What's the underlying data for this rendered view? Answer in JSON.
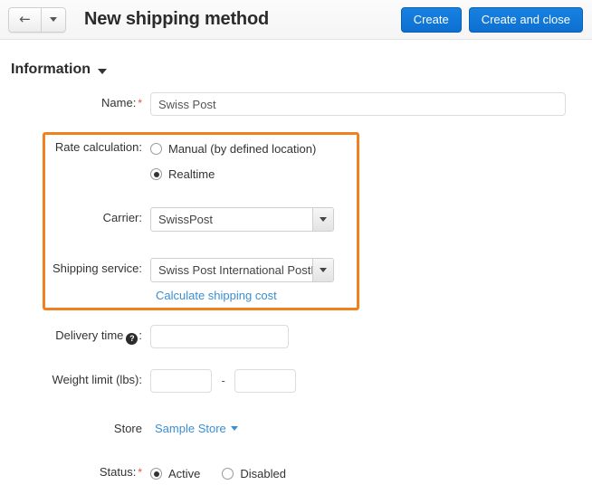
{
  "topbar": {
    "back_icon": "arrow-left-icon",
    "back_dropdown_icon": "caret-down-icon",
    "title": "New shipping method",
    "create_label": "Create",
    "create_and_close_label": "Create and close",
    "accent_color": "#1176d6"
  },
  "section": {
    "title": "Information",
    "collapse_icon": "caret-down-icon"
  },
  "form": {
    "name": {
      "label": "Name:",
      "required": "*",
      "value": "Swiss Post",
      "placeholder": ""
    },
    "rate_calculation": {
      "label": "Rate calculation:",
      "options": [
        {
          "label": "Manual (by defined location)",
          "checked": false
        },
        {
          "label": "Realtime",
          "checked": true
        }
      ]
    },
    "carrier": {
      "label": "Carrier:",
      "value": "SwissPost"
    },
    "shipping_service": {
      "label": "Shipping service:",
      "value": "Swiss Post International PostPa"
    },
    "calculate_link": "Calculate shipping cost",
    "delivery_time": {
      "label": "Delivery time",
      "help_icon": "question-mark-icon",
      "suffix": ":",
      "value": "",
      "placeholder": ""
    },
    "weight_limit": {
      "label": "Weight limit (lbs):",
      "min_value": "",
      "max_value": "",
      "separator": "-",
      "placeholder": ""
    },
    "store": {
      "label": "Store",
      "value": "Sample Store",
      "caret_icon": "caret-down-icon"
    },
    "status": {
      "label": "Status:",
      "required": "*",
      "options": [
        {
          "label": "Active",
          "checked": true
        },
        {
          "label": "Disabled",
          "checked": false
        }
      ]
    }
  },
  "highlight": {
    "color": "#f08020"
  }
}
